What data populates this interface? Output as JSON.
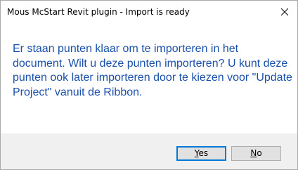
{
  "dialog": {
    "title": "Mous McStart Revit plugin - Import is ready",
    "close_label": "×",
    "message": "Er staan punten klaar om te importeren in het document. Wilt u deze punten importeren? U kunt deze punten ook later importeren door te kiezen voor \"Update Project\" vanuit de Ribbon.",
    "message_color": "#1a50ab",
    "buttons": {
      "yes": {
        "label": "Yes",
        "mnemonic": "Y",
        "rest": "es"
      },
      "no": {
        "label": "No",
        "mnemonic": "N",
        "rest": "o"
      }
    }
  },
  "icons": {
    "close": "close-icon"
  }
}
